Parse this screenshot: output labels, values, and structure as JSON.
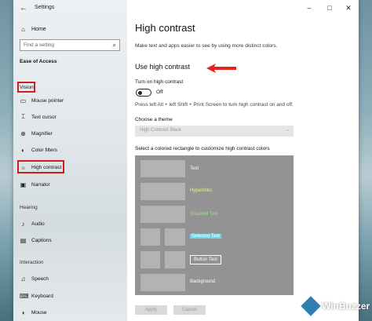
{
  "window": {
    "title": "Settings",
    "back_glyph": "←",
    "minimize": "–",
    "maximize": "□",
    "close": "✕"
  },
  "sidebar": {
    "home": "Home",
    "search_placeholder": "Find a setting",
    "category": "Ease of Access",
    "sections": {
      "vision": "Vision",
      "hearing": "Hearing",
      "interaction": "Interaction"
    },
    "vision_items": [
      {
        "label": "Mouse pointer",
        "icon": "mouse-pointer-icon"
      },
      {
        "label": "Text cursor",
        "icon": "text-cursor-icon"
      },
      {
        "label": "Magnifier",
        "icon": "magnifier-icon"
      },
      {
        "label": "Color filters",
        "icon": "color-filters-icon"
      },
      {
        "label": "High contrast",
        "icon": "high-contrast-icon"
      },
      {
        "label": "Narrator",
        "icon": "narrator-icon"
      }
    ],
    "hearing_items": [
      {
        "label": "Audio",
        "icon": "audio-icon"
      },
      {
        "label": "Captions",
        "icon": "captions-icon"
      }
    ],
    "interaction_items": [
      {
        "label": "Speech",
        "icon": "speech-icon"
      },
      {
        "label": "Keyboard",
        "icon": "keyboard-icon"
      },
      {
        "label": "Mouse",
        "icon": "mouse-icon"
      }
    ]
  },
  "main": {
    "title": "High contrast",
    "description": "Make text and apps easier to see by using more distinct colors.",
    "section_title": "Use high contrast",
    "toggle_label": "Turn on high contrast",
    "toggle_state": "Off",
    "shortcut_hint": "Press left Alt + left Shift + Print Screen to turn high contrast on and off.",
    "theme_label": "Choose a theme",
    "theme_value": "High Contrast Black",
    "customize_label": "Select a colored rectangle to customize high contrast colors",
    "preview": {
      "text": "Text",
      "hyperlinks": "Hyperlinks",
      "disabled_text": "Disabled Text",
      "selected_text": "Selected Text",
      "button_text": "Button Text",
      "background": "Background"
    },
    "apply_button": "Apply",
    "cancel_button": "Cancel"
  },
  "colors": {
    "accent_red": "#d01c1c",
    "hyperlink": "#f5f07a",
    "disabled": "#9fe08a",
    "selected_bg": "#6fd6e6",
    "preview_bg": "#939393"
  },
  "watermark": "WinBuzzer"
}
